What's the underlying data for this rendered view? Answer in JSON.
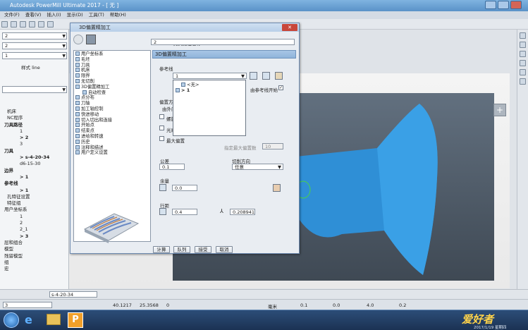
{
  "window": {
    "title": "Autodesk PowerMill Ultimate 2017 - [ 无 ]"
  },
  "menu": [
    "文件(F)",
    "查看(V)",
    "插入(I)",
    "显示(D)",
    "工具(T)",
    "帮助(H)"
  ],
  "left": {
    "combo1": "2",
    "combo2": "2",
    "combo3": "1",
    "style_label": "样式 line",
    "tree": [
      "机床",
      "NC程序",
      "刀具路径",
      "1",
      "> 2",
      "3",
      "刀具",
      "> s-4-20-34",
      "d6-15-30",
      "边界",
      "> 1",
      "参考线",
      "> 1",
      "孔特征设置",
      "特征组",
      "用户坐标系",
      "1",
      "2",
      "2_1",
      "> 3",
      "层和组合",
      "模型",
      "残留模型",
      "组",
      "宏"
    ]
  },
  "dialog": {
    "title": "3D偏置精加工",
    "toolpath_name_label": "刀具路径名称",
    "toolpath_name": "2",
    "header": "3D偏置精加工",
    "tree": [
      "用户坐标系",
      "毛坯",
      "刀具",
      "机床",
      "限界",
      "无切削",
      "3D偏置精加工",
      "自动检查",
      "点分布",
      "刀轴",
      "加工轴控制",
      "快进移动",
      "切入切出和连接",
      "开始点",
      "结束点",
      "进给和转速",
      "历史",
      "注释和描述",
      "用户定义设置"
    ],
    "ref_label": "参考线",
    "ref_value": "1",
    "ref_options": [
      "<无>",
      "> 1"
    ],
    "start_label": "由参考线开始",
    "offset_label": "偏置方",
    "from_label": "由外向",
    "spiral_label": "螺旋",
    "smooth_label": "光顺",
    "max_offset_label": "最大偏置",
    "max_offset_count_label": "指定最大偏置数",
    "max_offset_count": "10",
    "tolerance_label": "公差",
    "tolerance": "0.1",
    "cut_dir_label": "切削方向",
    "cut_dir": "任意",
    "allowance_label": "余量",
    "allowance": "0.0",
    "stepover_label": "行距",
    "stepover": "0.4",
    "stepover2": "0.208941",
    "buttons": [
      "计算",
      "队列",
      "接受",
      "取消"
    ]
  },
  "bottom": {
    "tool": "s-4-20-34",
    "layer": "3",
    "x": "40.1217",
    "y": "25.3568",
    "z": "0",
    "unit": "毫米",
    "v1": "0.1",
    "v2": "0.0",
    "v3": "4.0",
    "v4": "0.2"
  },
  "taskbar": {
    "watermark": "爱好者",
    "date": "2017/1/19 星期四"
  }
}
